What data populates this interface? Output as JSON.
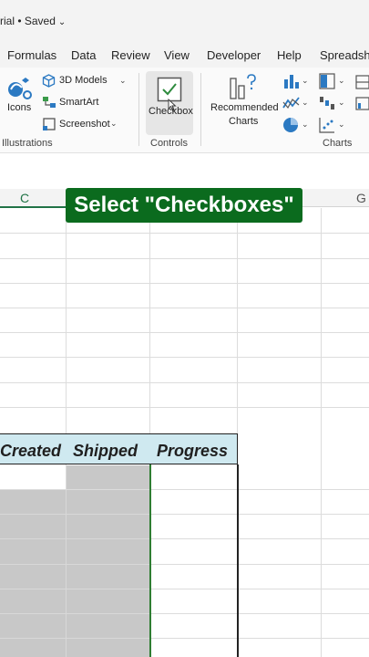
{
  "titlebar": {
    "doc_title": "rial • Saved"
  },
  "tabs": [
    "Formulas",
    "Data",
    "Review",
    "View",
    "Developer",
    "Help",
    "Spreadsheet"
  ],
  "ribbon": {
    "illustrations": {
      "icons_label": "Icons",
      "models_label": "3D Models",
      "smartart_label": "SmartArt",
      "screenshot_label": "Screenshot",
      "group_label": "Illustrations"
    },
    "controls": {
      "checkbox_label": "Checkbox",
      "group_label": "Controls"
    },
    "charts": {
      "recommended_line1": "Recommended",
      "recommended_line2": "Charts",
      "group_label": "Charts"
    }
  },
  "grid": {
    "col_c": "C",
    "col_g": "G"
  },
  "table": {
    "headers": [
      "Created",
      "Shipped",
      "Progress"
    ]
  },
  "overlay": {
    "caption": "Select \"Checkboxes\""
  },
  "colors": {
    "accent": "#217346",
    "caption_bg": "#0b6b1e",
    "header_fill": "#cfe9f0"
  }
}
